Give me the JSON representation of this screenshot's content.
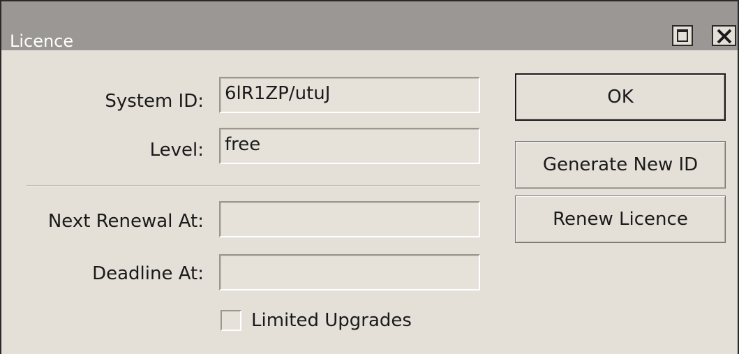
{
  "window": {
    "title": "Licence"
  },
  "form": {
    "system_id": {
      "label": "System ID:",
      "value": "6lR1ZP/utuJ"
    },
    "level": {
      "label": "Level:",
      "value": "free"
    },
    "next_renewal": {
      "label": "Next Renewal At:",
      "value": ""
    },
    "deadline": {
      "label": "Deadline At:",
      "value": ""
    },
    "limited_upgrades": {
      "label": "Limited Upgrades",
      "checked": false
    }
  },
  "buttons": {
    "ok": "OK",
    "generate_new_id": "Generate New ID",
    "renew_licence": "Renew Licence"
  },
  "icons": {
    "maximize": "maximize-icon",
    "close": "close-icon"
  },
  "colors": {
    "titlebar": "#9a9794",
    "window_bg": "#e4e0d8"
  }
}
